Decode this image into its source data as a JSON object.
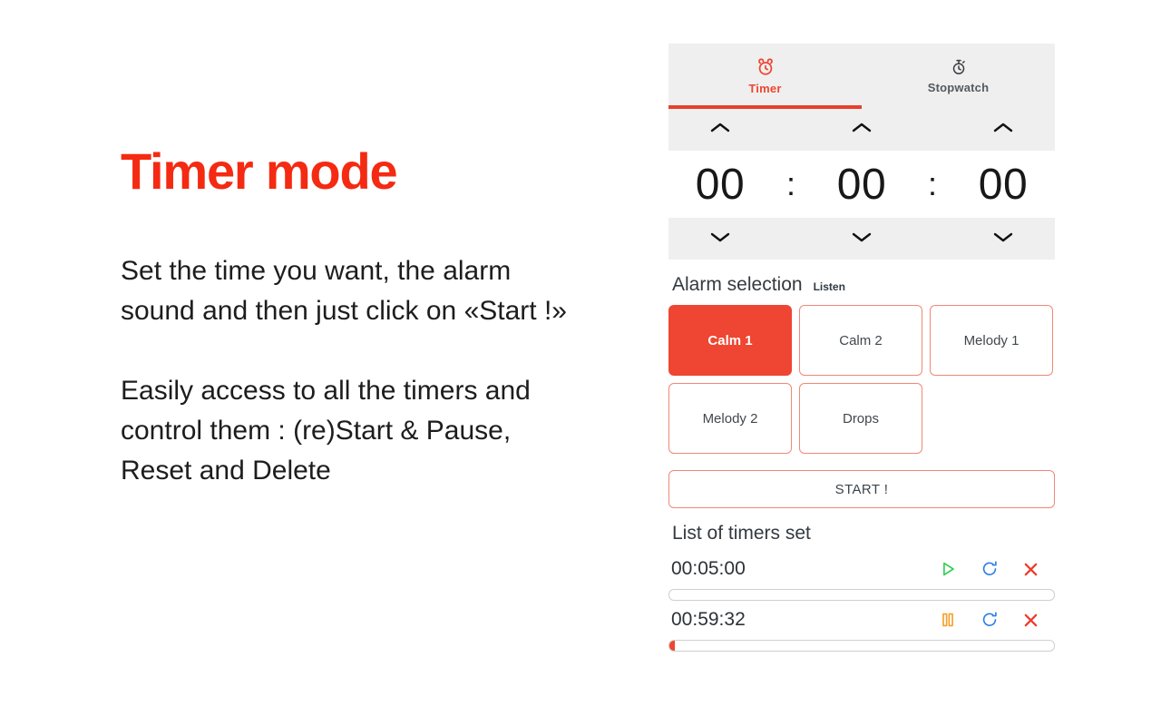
{
  "slide": {
    "headline": "Timer mode",
    "paragraphs": [
      "Set the time you want, the alarm sound and then just click on «Start !»",
      "Easily access to all the timers and control them : (re)Start & Pause, Reset and Delete"
    ]
  },
  "colors": {
    "accent_red": "#EE4632",
    "headline_red": "#F42A12",
    "band_gray": "#efefef",
    "outline_salmon": "#F08878",
    "play_green": "#33CC55",
    "pause_orange": "#F5A02A",
    "reset_blue": "#2C7FE8",
    "delete_red": "#EE3B2E"
  },
  "app": {
    "tabs": [
      {
        "label": "Timer",
        "icon": "alarm-clock-icon",
        "active": true
      },
      {
        "label": "Stopwatch",
        "icon": "stopwatch-icon",
        "active": false
      }
    ],
    "time_picker": {
      "up_icon": "chevron-up-icon",
      "down_icon": "chevron-down-icon",
      "hours": "00",
      "minutes": "00",
      "seconds": "00",
      "separator": ":"
    },
    "alarm_selection": {
      "title": "Alarm selection",
      "listen_label": "Listen",
      "options": [
        {
          "label": "Calm 1",
          "selected": true
        },
        {
          "label": "Calm 2",
          "selected": false
        },
        {
          "label": "Melody 1",
          "selected": false
        },
        {
          "label": "Melody 2",
          "selected": false
        },
        {
          "label": "Drops",
          "selected": false
        }
      ]
    },
    "start_button": "START !",
    "timer_list": {
      "title": "List of timers set",
      "items": [
        {
          "time": "00:05:00",
          "state": "paused",
          "toggle_icon": "play-icon",
          "reset_icon": "reset-icon",
          "delete_icon": "close-icon",
          "progress_percent": 0
        },
        {
          "time": "00:59:32",
          "state": "running",
          "toggle_icon": "pause-icon",
          "reset_icon": "reset-icon",
          "delete_icon": "close-icon",
          "progress_percent": 1.5
        }
      ]
    }
  }
}
